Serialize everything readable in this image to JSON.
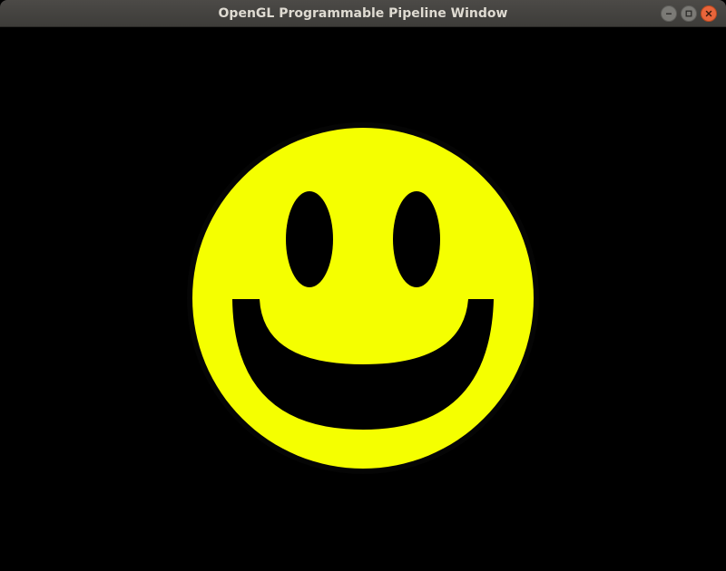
{
  "window": {
    "title": "OpenGL Programmable Pipeline Window"
  },
  "colors": {
    "face": "#f5ff00",
    "background": "#000000",
    "features": "#000000"
  },
  "icons": {
    "minimize": "minimize-icon",
    "maximize": "maximize-icon",
    "close": "close-icon"
  },
  "scene": {
    "description_object": "smiley-face"
  }
}
